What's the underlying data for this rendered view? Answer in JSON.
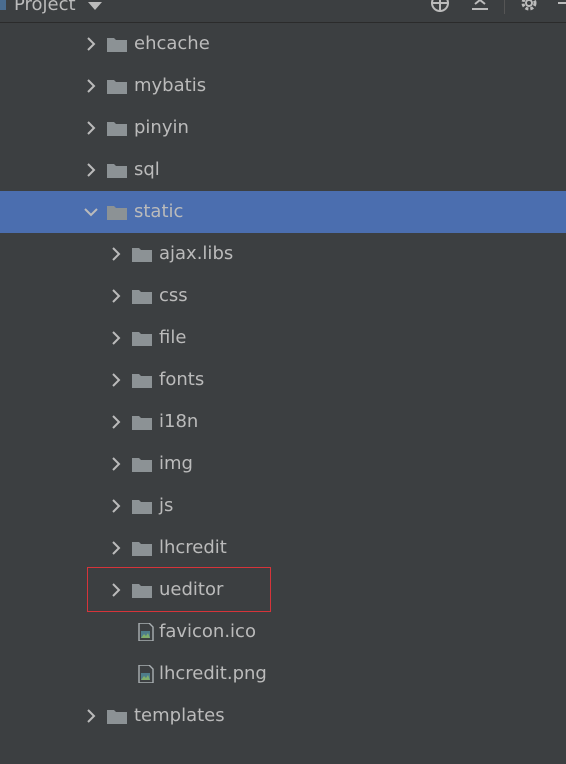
{
  "header": {
    "title": "Project"
  },
  "tree": [
    {
      "label": "ehcache",
      "depth": 1,
      "type": "folder",
      "expanded": false
    },
    {
      "label": "mybatis",
      "depth": 1,
      "type": "folder",
      "expanded": false
    },
    {
      "label": "pinyin",
      "depth": 1,
      "type": "folder",
      "expanded": false
    },
    {
      "label": "sql",
      "depth": 1,
      "type": "folder",
      "expanded": false
    },
    {
      "label": "static",
      "depth": 1,
      "type": "folder",
      "expanded": true,
      "selected": true
    },
    {
      "label": "ajax.libs",
      "depth": 2,
      "type": "folder",
      "expanded": false
    },
    {
      "label": "css",
      "depth": 2,
      "type": "folder",
      "expanded": false
    },
    {
      "label": "file",
      "depth": 2,
      "type": "folder",
      "expanded": false
    },
    {
      "label": "fonts",
      "depth": 2,
      "type": "folder",
      "expanded": false
    },
    {
      "label": "i18n",
      "depth": 2,
      "type": "folder",
      "expanded": false
    },
    {
      "label": "img",
      "depth": 2,
      "type": "folder",
      "expanded": false
    },
    {
      "label": "js",
      "depth": 2,
      "type": "folder",
      "expanded": false
    },
    {
      "label": "lhcredit",
      "depth": 2,
      "type": "folder",
      "expanded": false
    },
    {
      "label": "ueditor",
      "depth": 2,
      "type": "folder",
      "expanded": false,
      "highlighted": true
    },
    {
      "label": "favicon.ico",
      "depth": 2,
      "type": "image-file"
    },
    {
      "label": "lhcredit.png",
      "depth": 2,
      "type": "image-file"
    },
    {
      "label": "templates",
      "depth": 1,
      "type": "folder",
      "expanded": false
    }
  ],
  "colors": {
    "background": "#3c3f41",
    "selection": "#4b6eaf",
    "folder": "#8c9295",
    "text": "#bbbbbb",
    "highlight_border": "#d6343a"
  }
}
